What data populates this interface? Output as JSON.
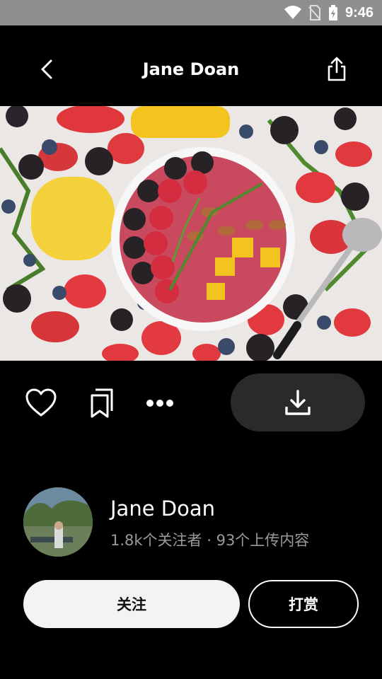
{
  "status": {
    "time": "9:46",
    "icons": [
      "wifi-icon",
      "no-sim-icon",
      "battery-icon"
    ]
  },
  "header": {
    "title": "Jane Doan",
    "back_icon": "chevron-left-icon",
    "share_icon": "share-icon"
  },
  "photo": {
    "subject": "fruit smoothie bowl"
  },
  "actions": {
    "like_icon": "heart-icon",
    "collect_icon": "bookmark-icon",
    "more_icon": "more-icon",
    "download_icon": "download-icon"
  },
  "profile": {
    "name": "Jane Doan",
    "stats": "1.8k个关注者 · 93个上传内容"
  },
  "buttons": {
    "follow_label": "关注",
    "tip_label": "打赏"
  },
  "colors": {
    "status_bar": "#8f8f8f",
    "background": "#000000",
    "download_button": "#2a2a2a",
    "follow_button": "#f3f3f3"
  }
}
